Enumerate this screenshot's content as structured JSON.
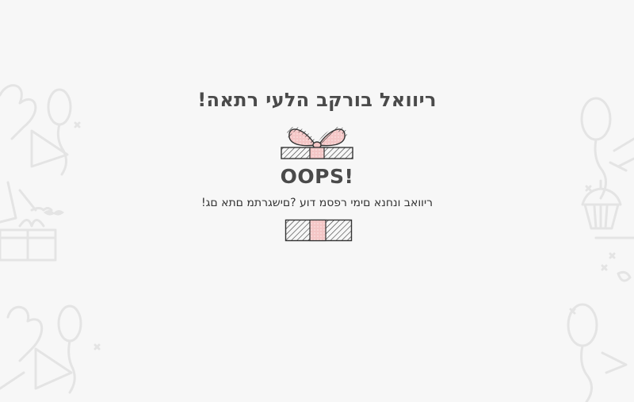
{
  "headline": "ריוואל בורקב הלעי רתאה!",
  "oops": "OOPS!",
  "message": "ריוואב ונחנא םימי רפסמ דוע ?םישגרתמ םתא םג!",
  "colors": {
    "background": "#f7f7f7",
    "text": "#4a4a4a",
    "ribbon_pink": "#f4c6c6",
    "doodle": "#e6e6e6"
  },
  "icons": {
    "top_gift": "gift-with-bow-icon",
    "bottom_gift": "gift-box-icon"
  }
}
